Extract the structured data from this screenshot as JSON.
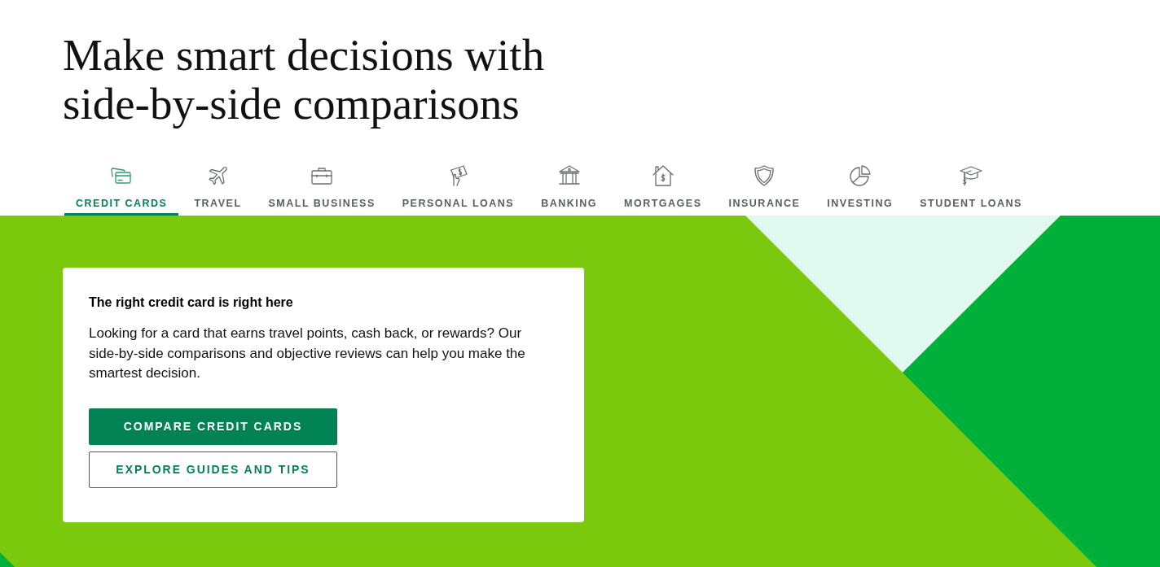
{
  "heading": "Make smart decisions with side-by-side comparisons",
  "tabs": [
    {
      "label": "CREDIT CARDS",
      "selected": true
    },
    {
      "label": "TRAVEL",
      "selected": false
    },
    {
      "label": "SMALL BUSINESS",
      "selected": false
    },
    {
      "label": "PERSONAL LOANS",
      "selected": false
    },
    {
      "label": "BANKING",
      "selected": false
    },
    {
      "label": "MORTGAGES",
      "selected": false
    },
    {
      "label": "INSURANCE",
      "selected": false
    },
    {
      "label": "INVESTING",
      "selected": false
    },
    {
      "label": "STUDENT LOANS",
      "selected": false
    }
  ],
  "card": {
    "title": "The right credit card is right here",
    "body": "Looking for a card that earns travel points, cash back, or rewards? Our side-by-side comparisons and objective reviews can help you make the smartest decision."
  },
  "buttons": [
    {
      "label": "COMPARE CREDIT CARDS",
      "kind": "primary"
    },
    {
      "label": "EXPLORE GUIDES AND TIPS",
      "kind": "outline"
    }
  ]
}
